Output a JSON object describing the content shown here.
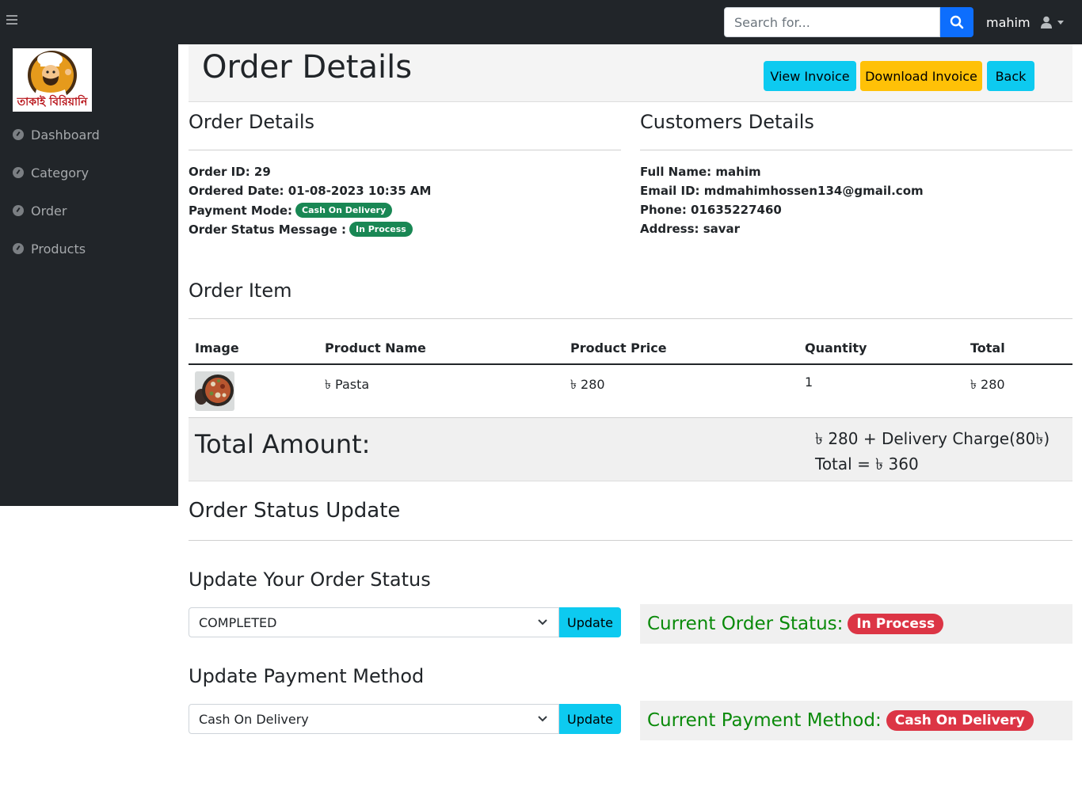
{
  "topbar": {
    "search_placeholder": "Search for...",
    "username": "mahim",
    "accent_color": "#0d6efd"
  },
  "sidebar": {
    "logo_text": "তাকাই বিরিয়ানি",
    "items": [
      {
        "label": "Dashboard"
      },
      {
        "label": "Category"
      },
      {
        "label": "Order"
      },
      {
        "label": "Products"
      }
    ]
  },
  "header": {
    "title": "Order Details",
    "buttons": {
      "view_invoice": "View Invoice",
      "download_invoice": "Download Invoice",
      "back": "Back"
    }
  },
  "order_details": {
    "heading": "Order Details",
    "order_id": "Order ID: 29",
    "ordered_date": "Ordered Date: 01-08-2023 10:35 AM",
    "payment_mode_label": "Payment Mode:",
    "payment_mode_badge": "Cash On Delivery",
    "status_message_label": "Order Status Message :",
    "status_message_badge": "In Process"
  },
  "customer_details": {
    "heading": "Customers Details",
    "full_name": "Full Name: mahim",
    "email": "Email ID: mdmahimhossen134@gmail.com",
    "phone": "Phone: 01635227460",
    "address": "Address: savar"
  },
  "order_items": {
    "heading": "Order Item",
    "columns": [
      "Image",
      "Product Name",
      "Product Price",
      "Quantity",
      "Total"
    ],
    "rows": [
      {
        "product_name": "৳ Pasta",
        "price": "৳ 280",
        "quantity": "1",
        "total": "৳ 280"
      }
    ]
  },
  "totals": {
    "label": "Total Amount:",
    "breakdown": "৳ 280 + Delivery Charge(80৳)",
    "grand_total": "Total = ৳ 360"
  },
  "status_update": {
    "heading": "Order Status Update",
    "order_status_heading": "Update Your Order Status",
    "order_status_selected": "COMPLETED",
    "update_label": "Update",
    "current_status_label": "Current Order Status:",
    "current_status_value": "In Process",
    "payment_heading": "Update Payment Method",
    "payment_selected": "Cash On Delivery",
    "current_payment_label": "Current Payment Method:",
    "current_payment_value": "Cash On Delivery"
  }
}
